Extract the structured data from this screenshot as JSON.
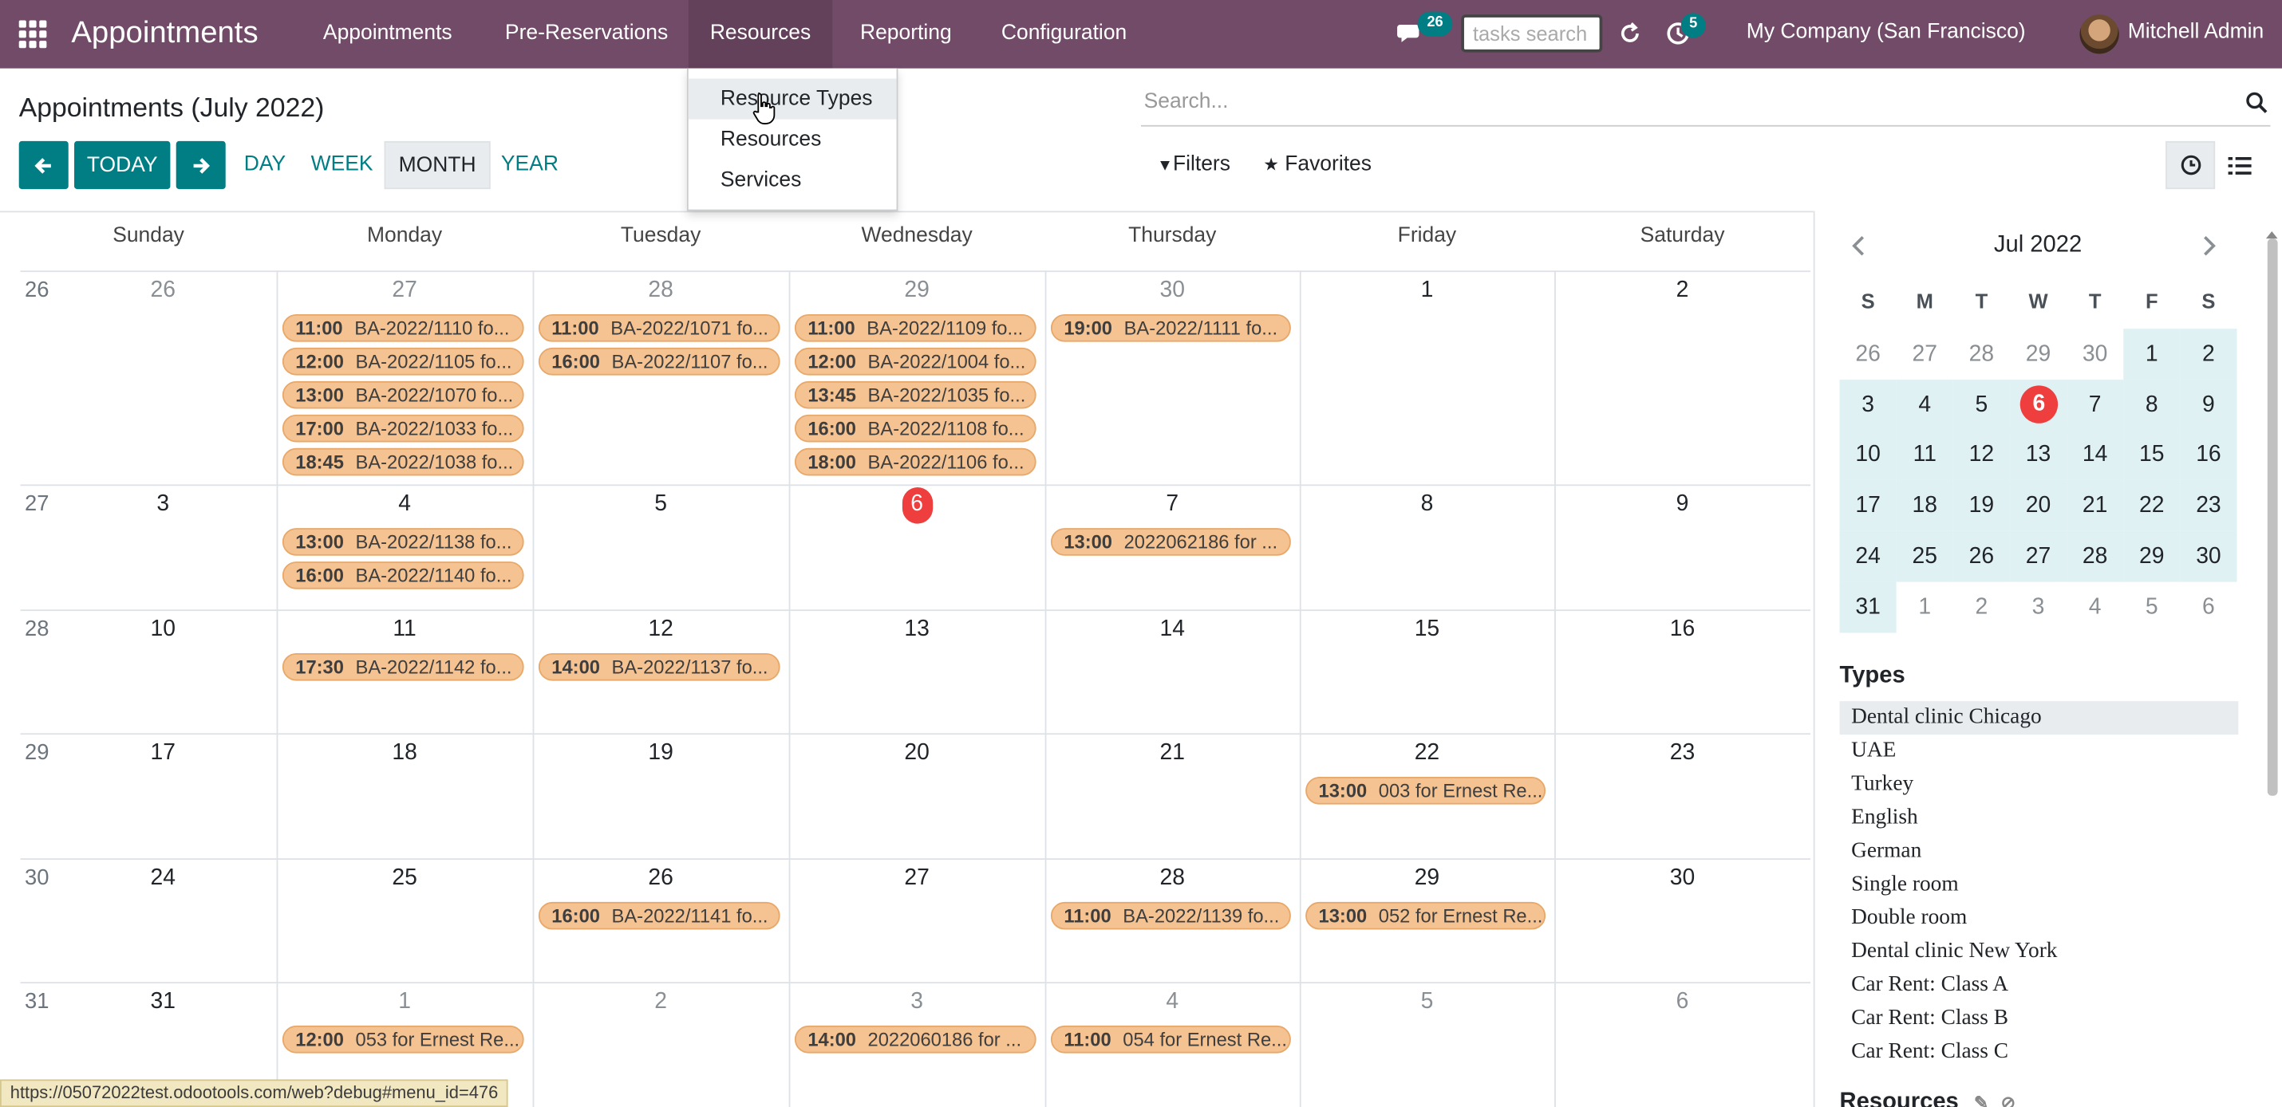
{
  "app_title": "Appointments",
  "menu": [
    "Appointments",
    "Pre-Reservations",
    "Resources",
    "Reporting",
    "Configuration"
  ],
  "systray": {
    "messages_badge": "26",
    "activities_badge": "5",
    "tasks_search_placeholder": "tasks search",
    "company": "My Company (San Francisco)",
    "user": "Mitchell Admin"
  },
  "resources_dropdown": [
    "Resource Types",
    "Resources",
    "Services"
  ],
  "page_title": "Appointments (July 2022)",
  "search_placeholder": "Search...",
  "nav": {
    "today": "TODAY",
    "scales": [
      "DAY",
      "WEEK",
      "MONTH",
      "YEAR"
    ],
    "active_scale": "MONTH"
  },
  "filters_label": "Filters",
  "favorites_label": "Favorites",
  "calendar": {
    "weekdays": [
      "Sunday",
      "Monday",
      "Tuesday",
      "Wednesday",
      "Thursday",
      "Friday",
      "Saturday"
    ],
    "weeks": [
      {
        "num": "26",
        "days": [
          "26",
          "27",
          "28",
          "29",
          "30",
          "1",
          "2"
        ],
        "other": [
          true,
          true,
          true,
          true,
          true,
          false,
          false
        ]
      },
      {
        "num": "27",
        "days": [
          "3",
          "4",
          "5",
          "6",
          "7",
          "8",
          "9"
        ],
        "other": [
          false,
          false,
          false,
          false,
          false,
          false,
          false
        ]
      },
      {
        "num": "28",
        "days": [
          "10",
          "11",
          "12",
          "13",
          "14",
          "15",
          "16"
        ],
        "other": [
          false,
          false,
          false,
          false,
          false,
          false,
          false
        ]
      },
      {
        "num": "29",
        "days": [
          "17",
          "18",
          "19",
          "20",
          "21",
          "22",
          "23"
        ],
        "other": [
          false,
          false,
          false,
          false,
          false,
          false,
          false
        ]
      },
      {
        "num": "30",
        "days": [
          "24",
          "25",
          "26",
          "27",
          "28",
          "29",
          "30"
        ],
        "other": [
          false,
          false,
          false,
          false,
          false,
          false,
          false
        ]
      },
      {
        "num": "31",
        "days": [
          "31",
          "1",
          "2",
          "3",
          "4",
          "5",
          "6"
        ],
        "other": [
          false,
          true,
          true,
          true,
          true,
          true,
          true
        ]
      }
    ],
    "today": "6",
    "events": [
      {
        "week": 0,
        "day": 1,
        "slot": 0,
        "time": "11:00",
        "title": "BA-2022/1110 fo..."
      },
      {
        "week": 0,
        "day": 1,
        "slot": 1,
        "time": "12:00",
        "title": "BA-2022/1105 fo..."
      },
      {
        "week": 0,
        "day": 1,
        "slot": 2,
        "time": "13:00",
        "title": "BA-2022/1070 fo..."
      },
      {
        "week": 0,
        "day": 1,
        "slot": 3,
        "time": "17:00",
        "title": "BA-2022/1033 fo..."
      },
      {
        "week": 0,
        "day": 1,
        "slot": 4,
        "time": "18:45",
        "title": "BA-2022/1038 fo..."
      },
      {
        "week": 0,
        "day": 2,
        "slot": 0,
        "time": "11:00",
        "title": "BA-2022/1071 fo..."
      },
      {
        "week": 0,
        "day": 2,
        "slot": 1,
        "time": "16:00",
        "title": "BA-2022/1107 fo..."
      },
      {
        "week": 0,
        "day": 3,
        "slot": 0,
        "time": "11:00",
        "title": "BA-2022/1109 fo..."
      },
      {
        "week": 0,
        "day": 3,
        "slot": 1,
        "time": "12:00",
        "title": "BA-2022/1004 fo..."
      },
      {
        "week": 0,
        "day": 3,
        "slot": 2,
        "time": "13:45",
        "title": "BA-2022/1035 fo..."
      },
      {
        "week": 0,
        "day": 3,
        "slot": 3,
        "time": "16:00",
        "title": "BA-2022/1108 fo..."
      },
      {
        "week": 0,
        "day": 3,
        "slot": 4,
        "time": "18:00",
        "title": "BA-2022/1106 fo..."
      },
      {
        "week": 0,
        "day": 4,
        "slot": 0,
        "time": "19:00",
        "title": "BA-2022/1111 fo..."
      },
      {
        "week": 1,
        "day": 1,
        "slot": 0,
        "time": "13:00",
        "title": "BA-2022/1138 fo..."
      },
      {
        "week": 1,
        "day": 1,
        "slot": 1,
        "time": "16:00",
        "title": "BA-2022/1140 fo..."
      },
      {
        "week": 1,
        "day": 4,
        "slot": 0,
        "time": "13:00",
        "title": "2022062186 for ..."
      },
      {
        "week": 2,
        "day": 1,
        "slot": 0,
        "time": "17:30",
        "title": "BA-2022/1142 fo..."
      },
      {
        "week": 2,
        "day": 2,
        "slot": 0,
        "time": "14:00",
        "title": "BA-2022/1137 fo..."
      },
      {
        "week": 3,
        "day": 5,
        "slot": 0,
        "time": "13:00",
        "title": "003 for Ernest Re..."
      },
      {
        "week": 4,
        "day": 2,
        "slot": 0,
        "time": "16:00",
        "title": "BA-2022/1141 fo..."
      },
      {
        "week": 4,
        "day": 4,
        "slot": 0,
        "time": "11:00",
        "title": "BA-2022/1139 fo..."
      },
      {
        "week": 4,
        "day": 5,
        "slot": 0,
        "time": "13:00",
        "title": "052 for Ernest Re..."
      },
      {
        "week": 5,
        "day": 1,
        "slot": 0,
        "time": "12:00",
        "title": "053 for Ernest Re..."
      },
      {
        "week": 5,
        "day": 3,
        "slot": 0,
        "time": "14:00",
        "title": "2022060186 for ..."
      },
      {
        "week": 5,
        "day": 4,
        "slot": 0,
        "time": "11:00",
        "title": "054 for Ernest Re..."
      }
    ]
  },
  "mini_calendar": {
    "title": "Jul 2022",
    "dow": [
      "S",
      "M",
      "T",
      "W",
      "T",
      "F",
      "S"
    ],
    "rows": [
      [
        "26",
        "27",
        "28",
        "29",
        "30",
        "1",
        "2"
      ],
      [
        "3",
        "4",
        "5",
        "6",
        "7",
        "8",
        "9"
      ],
      [
        "10",
        "11",
        "12",
        "13",
        "14",
        "15",
        "16"
      ],
      [
        "17",
        "18",
        "19",
        "20",
        "21",
        "22",
        "23"
      ],
      [
        "24",
        "25",
        "26",
        "27",
        "28",
        "29",
        "30"
      ],
      [
        "31",
        "1",
        "2",
        "3",
        "4",
        "5",
        "6"
      ]
    ]
  },
  "types_heading": "Types",
  "types": [
    "Dental clinic Chicago",
    "UAE",
    "Turkey",
    "English",
    "German",
    "Single room",
    "Double room",
    "Dental clinic New York",
    "Car Rent: Class A",
    "Car Rent: Class B",
    "Car Rent: Class C"
  ],
  "resources_heading": "Resources",
  "status_url": "https://05072022test.odootools.com/web?debug#menu_id=476",
  "colors": {
    "navbar": "#714b67",
    "accent": "#017e84",
    "event_bg": "#f5c291",
    "today": "#ef3e3e",
    "mini_in_month": "#e0f1f3"
  }
}
